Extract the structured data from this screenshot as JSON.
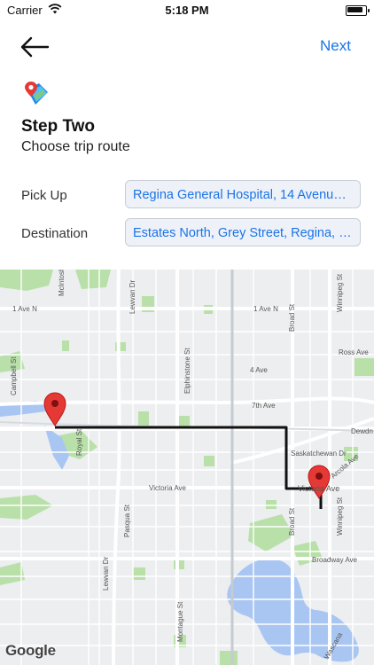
{
  "status_bar": {
    "carrier": "Carrier",
    "time": "5:18 PM"
  },
  "nav": {
    "next_label": "Next",
    "back_icon": "back-arrow-icon"
  },
  "header": {
    "logo_icon": "map-pin-icon",
    "title": "Step Two",
    "subtitle": "Choose trip route"
  },
  "form": {
    "pickup": {
      "label": "Pick Up",
      "value": "Regina General Hospital, 14 Avenue,..."
    },
    "destination": {
      "label": "Destination",
      "value": "Estates North, Grey Street, Regina, S..."
    }
  },
  "map": {
    "attribution": "Google",
    "route_color": "#111111",
    "marker_color": "#e53935",
    "street_labels": {
      "mcintosh": "McIntosh St",
      "av1_w": "1 Ave N",
      "av1_e": "1 Ave N",
      "lewvan_n": "Lewvan Dr",
      "elphinstone": "Elphinstone St",
      "broad_n": "Broad St",
      "winnipeg_n": "Winnipeg St",
      "ross": "Ross Ave",
      "av4": "4 Ave",
      "campbell": "Campbell St",
      "av7": "7th Ave",
      "royal": "Royal St",
      "dewdney": "Dewdn",
      "sask": "Saskatchewan Dr",
      "arcola": "Arcola Ave",
      "victoria_w": "Victoria Ave",
      "victoria_e": "Victoria Ave",
      "pasqua": "Pasqua St",
      "broad_s": "Broad St",
      "winnipeg_s": "Winnipeg St",
      "broadway": "Broadway Ave",
      "lewvan_s": "Lewvan Dr",
      "montague": "Montague St",
      "wascana": "Wascana"
    }
  }
}
